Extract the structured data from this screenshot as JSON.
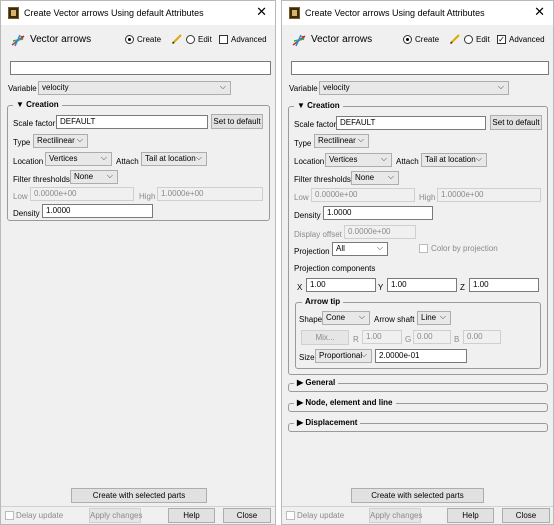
{
  "window_title": "Create Vector arrows Using default Attributes",
  "header": {
    "title": "Vector arrows",
    "create_label": "Create",
    "edit_label": "Edit",
    "advanced_label": "Advanced"
  },
  "name_field": {
    "value": ""
  },
  "variable": {
    "label": "Variable",
    "value": "velocity"
  },
  "creation": {
    "title": "Creation",
    "scale_factor_label": "Scale factor",
    "scale_factor_value": "DEFAULT",
    "set_default_label": "Set to default",
    "type_label": "Type",
    "type_value": "Rectilinear",
    "location_label": "Location",
    "location_value": "Vertices",
    "attach_label": "Attach",
    "attach_value": "Tail at location",
    "filter_label": "Filter thresholds",
    "filter_value": "None",
    "low_label": "Low",
    "low_value": "0.0000e+00",
    "high_label": "High",
    "high_value": "1.0000e+00",
    "density_label": "Density",
    "density_value": "1.0000",
    "display_offset_label": "Display offset",
    "display_offset_value": "0.0000e+00",
    "projection_label": "Projection",
    "projection_value": "All",
    "color_by_projection_label": "Color by projection",
    "projection_components_label": "Projection components",
    "x_label": "X",
    "x_value": "1.00",
    "y_label": "Y",
    "y_value": "1.00",
    "z_label": "Z",
    "z_value": "1.00"
  },
  "arrow_tip": {
    "title": "Arrow tip",
    "shape_label": "Shape",
    "shape_value": "Cone",
    "shaft_label": "Arrow shaft",
    "shaft_value": "Line",
    "mix_label": "Mix...",
    "r_label": "R",
    "r_value": "1.00",
    "g_label": "G",
    "g_value": "0.00",
    "b_label": "B",
    "b_value": "0.00",
    "size_label": "Size",
    "size_value": "Proportional",
    "size_number": "2.0000e-01"
  },
  "sections": [
    "General",
    "Node, element and line",
    "Displacement"
  ],
  "footer": {
    "create_parts_label": "Create with selected parts",
    "delay_update_label": "Delay update",
    "apply_label": "Apply changes",
    "help_label": "Help",
    "close_label": "Close"
  },
  "colors": {
    "window_bg": "#f0f0f0",
    "border": "#9a9a9a",
    "disabled_text": "#8a8a8a"
  }
}
